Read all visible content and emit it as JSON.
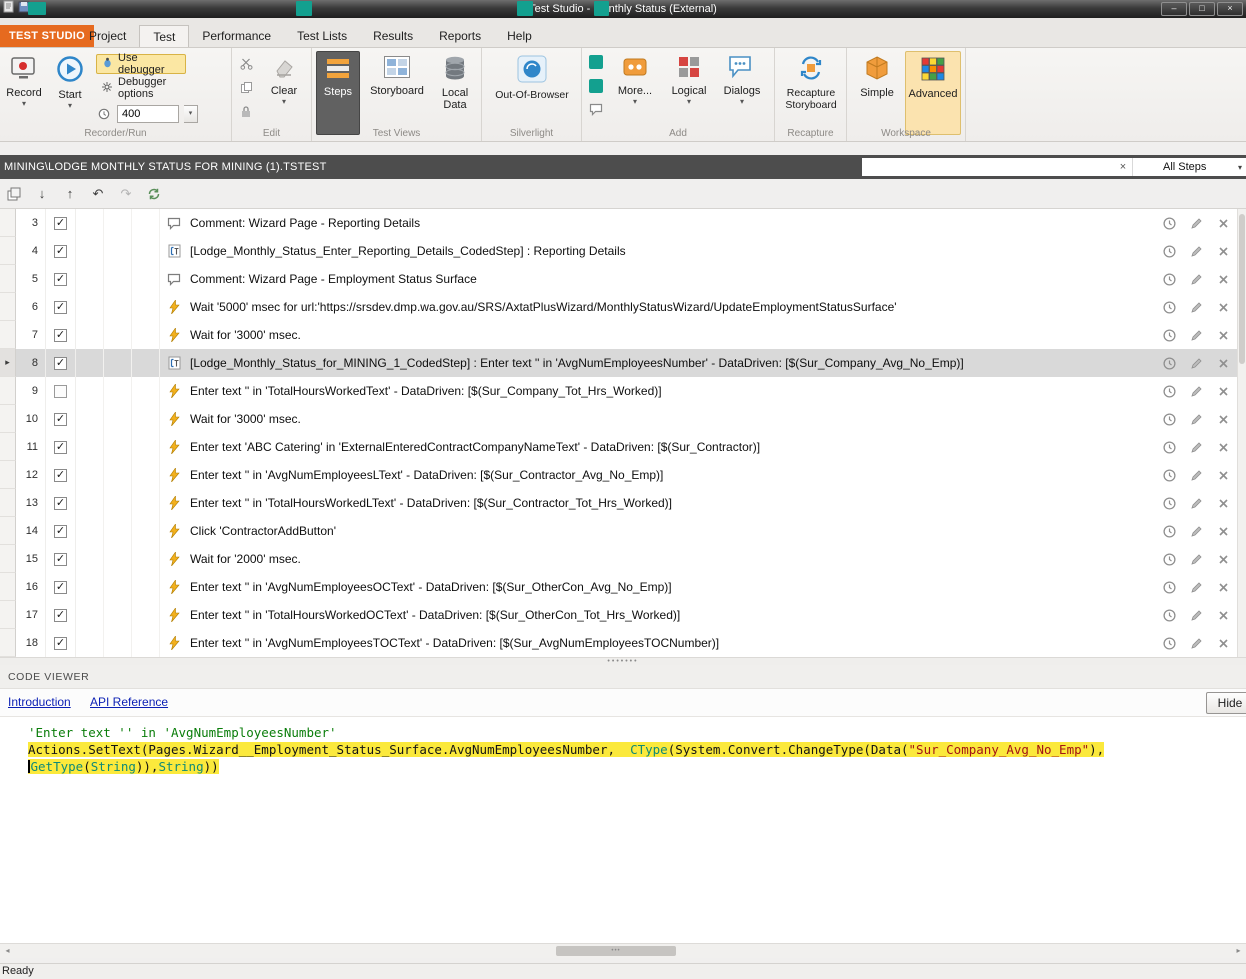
{
  "colors": {
    "accent_orange": "#e66a1f",
    "highlight_yellow": "#fbe93c",
    "selected_row_gray": "#d9d9d9",
    "redaction_teal": "#13a08f",
    "pathbar_gray": "#4d4d4d"
  },
  "icons": {
    "caret_down": "▾",
    "check": "✓",
    "selected_arrow": "▸",
    "arrow_up": "↑",
    "arrow_down": "↓",
    "undo": "↶",
    "redo": "↷",
    "dots": "•••••••",
    "grip_dots": "•••",
    "left_arrow": "◂",
    "right_arrow": "▸",
    "clear_x": "×"
  },
  "window": {
    "title": "Test Studio - Monthly Status (External)",
    "minimize": "–",
    "maximize": "□",
    "close": "×"
  },
  "menu": {
    "app_tab": "TEST STUDIO",
    "tabs": [
      {
        "label": "Project"
      },
      {
        "label": "Test",
        "active": true
      },
      {
        "label": "Performance"
      },
      {
        "label": "Test Lists"
      },
      {
        "label": "Results"
      },
      {
        "label": "Reports"
      },
      {
        "label": "Help"
      }
    ]
  },
  "ribbon": {
    "record": "Record",
    "start": "Start",
    "use_debugger": "Use debugger",
    "debugger_options": "Debugger options",
    "delay_value": "400",
    "clear": "Clear",
    "steps_view": "Steps",
    "storyboard": "Storyboard",
    "local_data": "Local Data",
    "out_of_browser": "Out-Of-Browser",
    "more": "More...",
    "logical": "Logical",
    "dialogs": "Dialogs",
    "recapture_storyboard": "Recapture Storyboard",
    "simple": "Simple",
    "advanced": "Advanced",
    "groups": {
      "recorder_run": "Recorder/Run",
      "edit": "Edit",
      "test_views": "Test Views",
      "silverlight": "Silverlight",
      "add": "Add",
      "recapture": "Recapture",
      "workspace": "Workspace"
    }
  },
  "pathbar": {
    "path": "MINING\\LODGE MONTHLY STATUS FOR MINING (1).TSTEST",
    "filter": "All Steps"
  },
  "steps": {
    "rows": [
      {
        "num": 3,
        "checked": true,
        "type": "comment",
        "text": "Comment: Wizard Page - Reporting Details"
      },
      {
        "num": 4,
        "checked": true,
        "type": "coded",
        "text": "[Lodge_Monthly_Status_Enter_Reporting_Details_CodedStep] : Reporting Details"
      },
      {
        "num": 5,
        "checked": true,
        "type": "comment",
        "text": "Comment: Wizard Page - Employment Status Surface"
      },
      {
        "num": 6,
        "checked": true,
        "type": "action",
        "text": "Wait '5000' msec for url:'https://srsdev.dmp.wa.gov.au/SRS/AxtatPlusWizard/MonthlyStatusWizard/UpdateEmploymentStatusSurface'"
      },
      {
        "num": 7,
        "checked": true,
        "type": "action",
        "text": "Wait for '3000' msec."
      },
      {
        "num": 8,
        "checked": true,
        "type": "coded",
        "selected": true,
        "text": "[Lodge_Monthly_Status_for_MINING_1_CodedStep] : Enter text '' in 'AvgNumEmployeesNumber' - DataDriven: [$(Sur_Company_Avg_No_Emp)]"
      },
      {
        "num": 9,
        "checked": false,
        "type": "action",
        "text": "Enter text '' in 'TotalHoursWorkedText' - DataDriven: [$(Sur_Company_Tot_Hrs_Worked)]"
      },
      {
        "num": 10,
        "checked": true,
        "type": "action",
        "text": "Wait for '3000' msec."
      },
      {
        "num": 11,
        "checked": true,
        "type": "action",
        "text": "Enter text 'ABC Catering' in 'ExternalEnteredContractCompanyNameText' - DataDriven: [$(Sur_Contractor)]"
      },
      {
        "num": 12,
        "checked": true,
        "type": "action",
        "text": "Enter text '' in 'AvgNumEmployeesLText' - DataDriven: [$(Sur_Contractor_Avg_No_Emp)]"
      },
      {
        "num": 13,
        "checked": true,
        "type": "action",
        "text": "Enter text '' in 'TotalHoursWorkedLText' - DataDriven: [$(Sur_Contractor_Tot_Hrs_Worked)]"
      },
      {
        "num": 14,
        "checked": true,
        "type": "action",
        "text": "Click 'ContractorAddButton'"
      },
      {
        "num": 15,
        "checked": true,
        "type": "action",
        "text": "Wait for '2000' msec."
      },
      {
        "num": 16,
        "checked": true,
        "type": "action",
        "text": "Enter text '' in 'AvgNumEmployeesOCText' - DataDriven: [$(Sur_OtherCon_Avg_No_Emp)]"
      },
      {
        "num": 17,
        "checked": true,
        "type": "action",
        "text": "Enter text '' in 'TotalHoursWorkedOCText' - DataDriven: [$(Sur_OtherCon_Tot_Hrs_Worked)]"
      },
      {
        "num": 18,
        "checked": true,
        "type": "action",
        "text": "Enter text '' in 'AvgNumEmployeesTOCText' - DataDriven: [$(Sur_AvgNumEmployeesTOCNumber)]"
      }
    ]
  },
  "code_viewer": {
    "header": "CODE VIEWER",
    "intro_link": "Introduction",
    "api_link": "API Reference",
    "hide_button": "Hide",
    "lines": [
      {
        "highlight": false,
        "segments": [
          {
            "t": "'Enter text '' in 'AvgNumEmployeesNumber'",
            "c": "comment"
          }
        ]
      },
      {
        "highlight": true,
        "segments": [
          {
            "t": "Actions.SetText(Pages.Wizard__Employment_Status_Surface.AvgNumEmployeesNumber,  ",
            "c": "plain"
          },
          {
            "t": "CType",
            "c": "keyword"
          },
          {
            "t": "(System.Convert.ChangeType(Data(",
            "c": "plain"
          },
          {
            "t": "\"Sur_Company_Avg_No_Emp\"",
            "c": "string"
          },
          {
            "t": "),",
            "c": "plain"
          }
        ]
      },
      {
        "highlight": true,
        "caret": true,
        "segments": [
          {
            "t": "GetType",
            "c": "keyword"
          },
          {
            "t": "(",
            "c": "plain"
          },
          {
            "t": "String",
            "c": "keyword"
          },
          {
            "t": ")),",
            "c": "plain"
          },
          {
            "t": "String",
            "c": "keyword"
          },
          {
            "t": "))",
            "c": "plain"
          }
        ]
      }
    ]
  },
  "status": {
    "ready": "Ready"
  }
}
